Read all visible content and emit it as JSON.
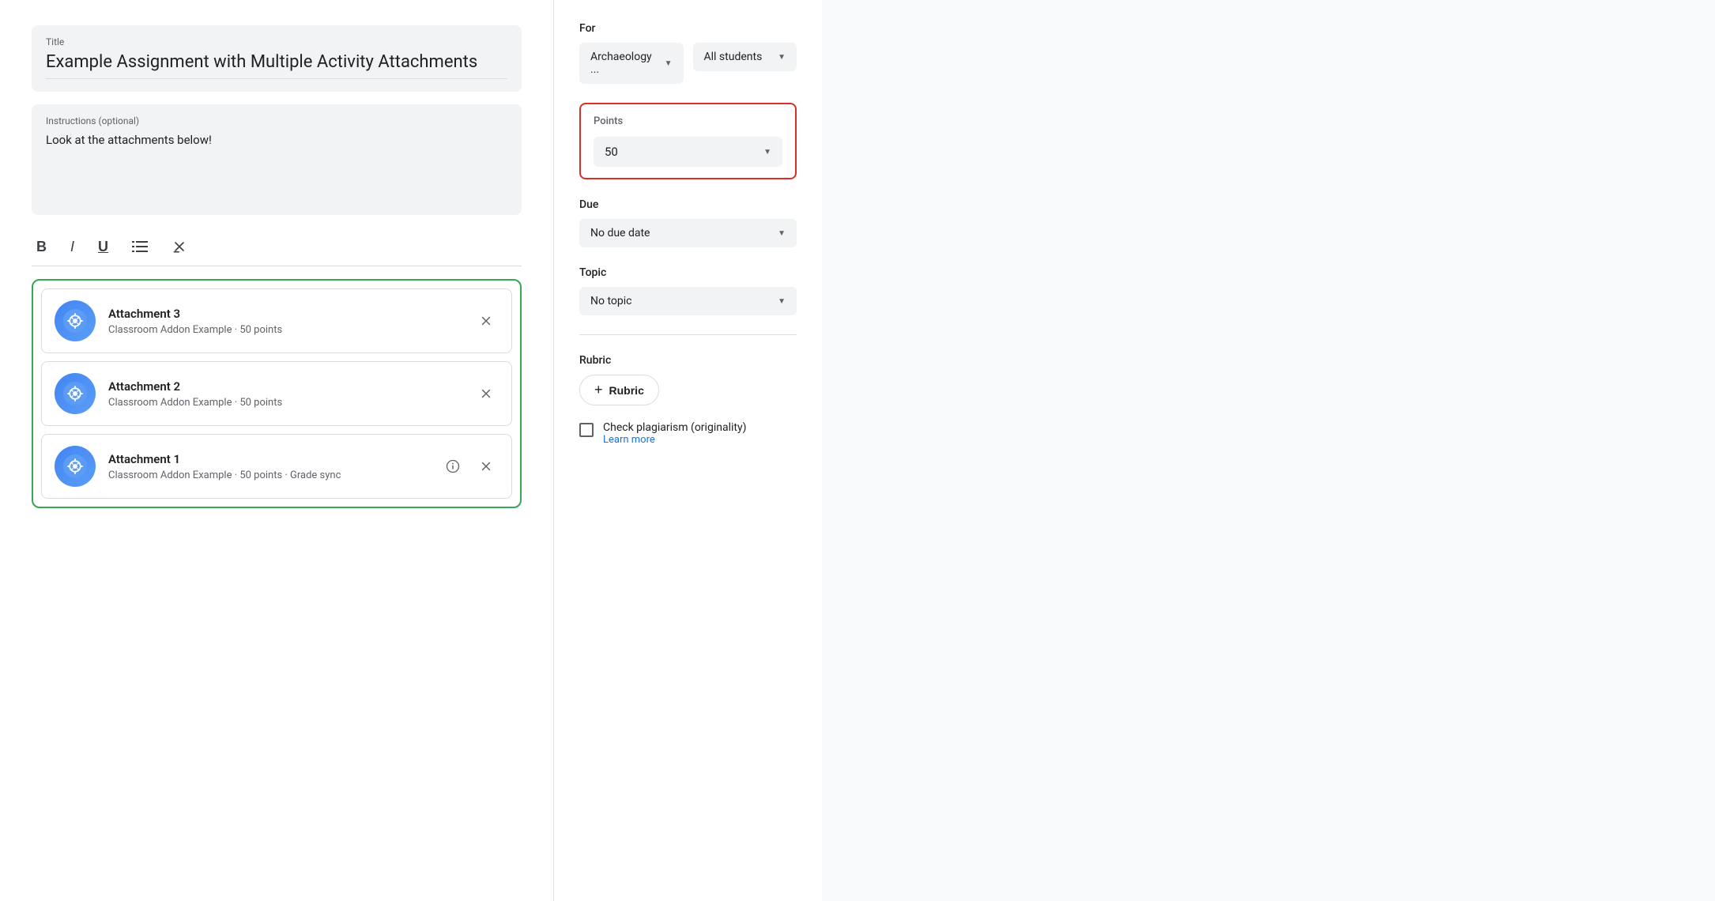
{
  "main": {
    "title_label": "Title",
    "title_value": "Example Assignment with Multiple Activity Attachments",
    "instructions_label": "Instructions (optional)",
    "instructions_value": "Look at the attachments below!",
    "toolbar": {
      "bold": "B",
      "italic": "I",
      "underline": "U",
      "list": "≡",
      "clear": "✕"
    },
    "attachments": [
      {
        "id": "attachment-3",
        "title": "Attachment 3",
        "subtitle": "Classroom Addon Example · 50 points",
        "has_info": false
      },
      {
        "id": "attachment-2",
        "title": "Attachment 2",
        "subtitle": "Classroom Addon Example · 50 points",
        "has_info": false
      },
      {
        "id": "attachment-1",
        "title": "Attachment 1",
        "subtitle": "Classroom Addon Example · 50 points · Grade sync",
        "has_info": true
      }
    ]
  },
  "sidebar": {
    "for_label": "For",
    "class_value": "Archaeology ...",
    "students_value": "All students",
    "points_label": "Points",
    "points_value": "50",
    "due_label": "Due",
    "due_value": "No due date",
    "topic_label": "Topic",
    "topic_value": "No topic",
    "rubric_label": "Rubric",
    "rubric_button": "+ Rubric",
    "rubric_plus": "+",
    "rubric_text": "Rubric",
    "plagiarism_label": "Check plagiarism (originality)",
    "plagiarism_link": "Learn more"
  }
}
